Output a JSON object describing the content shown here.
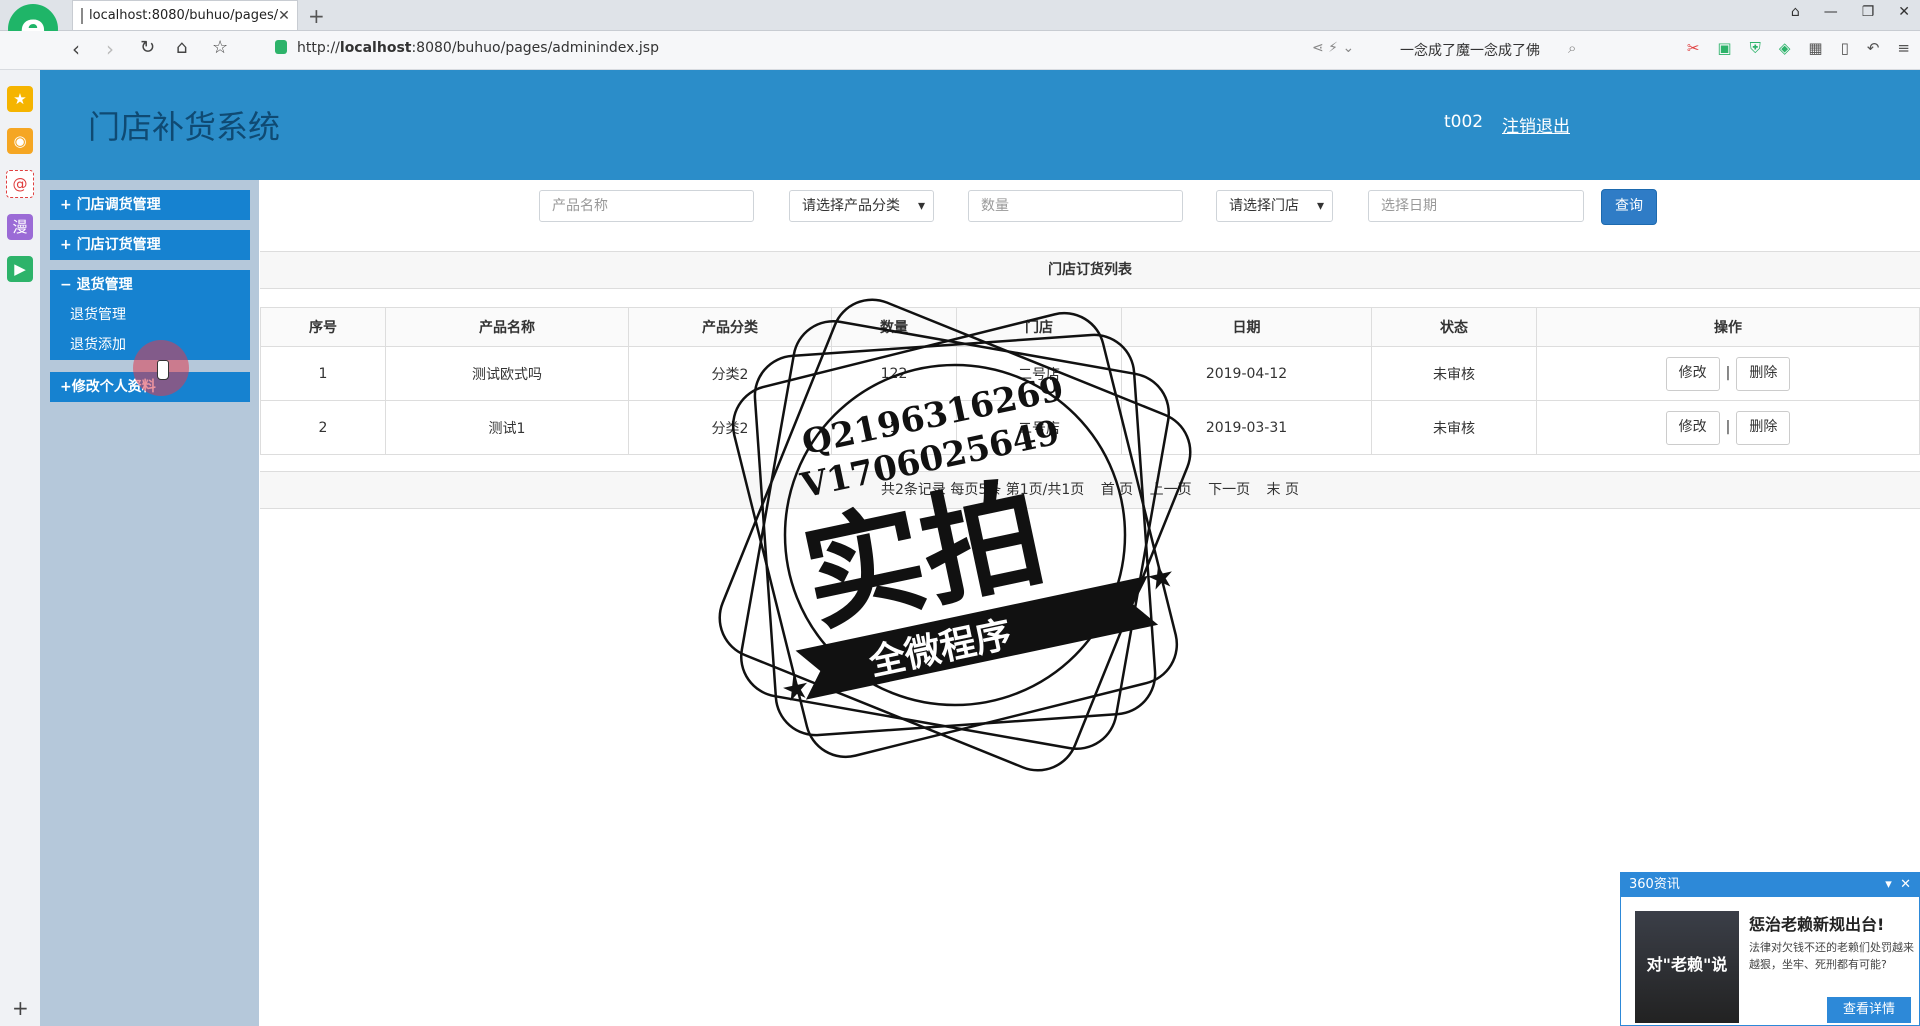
{
  "browser": {
    "tab_title": "localhost:8080/buhuo/pages/",
    "url_host_prefix": "http://",
    "url_host": "localhost",
    "url_rest": ":8080/buhuo/pages/adminindex.jsp",
    "search_text": "一念成了魔一念成了佛"
  },
  "app": {
    "title": "门店补货系统",
    "user": "t002",
    "logout": "注销退出"
  },
  "menu": {
    "group1": "+ 门店调货管理",
    "group2": "+ 门店订货管理",
    "group3": "− 退货管理",
    "sub1": "退货管理",
    "sub2": "退货添加",
    "group4": "+修改个人资料"
  },
  "search": {
    "product_name_placeholder": "产品名称",
    "category_select": "请选择产品分类",
    "quantity_placeholder": "数量",
    "store_select": "请选择门店",
    "date_placeholder": "选择日期",
    "query_button": "查询"
  },
  "table": {
    "caption": "门店订货列表",
    "headers": [
      "序号",
      "产品名称",
      "产品分类",
      "数量",
      "门店",
      "日期",
      "状态",
      "操作"
    ],
    "rows": [
      [
        "1",
        "测试欧式吗",
        "分类2",
        "122",
        "二号店",
        "2019-04-12",
        "未审核"
      ],
      [
        "2",
        "测试1",
        "分类2",
        "1",
        "二号店",
        "2019-03-31",
        "未审核"
      ]
    ],
    "edit_label": "修改",
    "delete_label": "删除",
    "separator": "|"
  },
  "pager": {
    "summary": "共2条记录 每页5条 第1页/共1页",
    "first": "首 页",
    "prev": "上一页",
    "next": "下一页",
    "last": "末 页"
  },
  "watermark": {
    "line1": "Q2196316269",
    "line2": "V1706025649",
    "main": "实拍",
    "banner": "全微程序"
  },
  "news": {
    "header": "360资讯",
    "title": "惩治老赖新规出台!",
    "text": "法律对欠钱不还的老赖们处罚越来越狠，坐牢、死刑都有可能?",
    "image_caption": "对\"老赖\"说",
    "button": "查看详情"
  },
  "colors": {
    "header_bg": "#2b8dc9",
    "menu_bg": "#b5c8da",
    "menu_item_bg": "#1682d0",
    "query_btn": "#2f7cc6"
  }
}
